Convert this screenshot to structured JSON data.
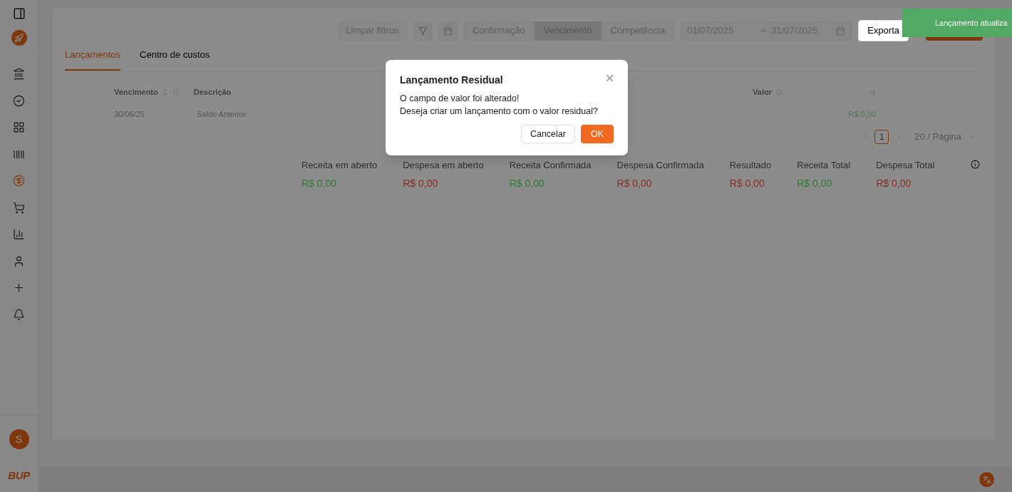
{
  "sidebar": {
    "nav_items": [
      {
        "kind": "bank",
        "selected": false
      },
      {
        "kind": "check",
        "selected": false
      },
      {
        "kind": "grid",
        "selected": false
      },
      {
        "kind": "barcode",
        "selected": false
      },
      {
        "kind": "dollar",
        "selected": true
      },
      {
        "kind": "cart",
        "selected": false
      },
      {
        "kind": "chart",
        "selected": false
      },
      {
        "kind": "user",
        "selected": false
      },
      {
        "kind": "plus",
        "selected": false
      },
      {
        "kind": "bell",
        "selected": false
      }
    ],
    "avatar": "S",
    "brand": "BUP"
  },
  "toolbar": {
    "clear_button": "Limpar filtros",
    "date_modes": [
      {
        "label": "Confirmação",
        "selected": false
      },
      {
        "label": "Vencimento",
        "selected": true
      },
      {
        "label": "Competência",
        "selected": false
      }
    ],
    "date_start": "01/07/2025",
    "date_end": "31/07/2025",
    "export_button": "Exporta"
  },
  "tabs": [
    {
      "label": "Lançamentos",
      "selected": true
    },
    {
      "label": "Centro de custos",
      "selected": false
    }
  ],
  "table": {
    "columns": [
      "Vencimento",
      "Descrição",
      "Valor"
    ],
    "rows": [
      {
        "date": "30/06/25",
        "description": "Saldo Anterior",
        "value": "R$ 0,00"
      }
    ]
  },
  "pagination": {
    "page": "1",
    "page_size": "20 / Página"
  },
  "summary": [
    {
      "label": "Receita em aberto",
      "value": "R$ 0,00",
      "color": "#2f7a34"
    },
    {
      "label": "Despesa em aberto",
      "value": "R$ 0,00",
      "color": "#8c2b22"
    },
    {
      "label": "Receita Confirmada",
      "value": "R$ 0,00",
      "color": "#2f7a34"
    },
    {
      "label": "Despesa Confirmada",
      "value": "R$ 0,00",
      "color": "#8c2b22"
    },
    {
      "label": "Resultado",
      "value": "R$ 0,00",
      "color": "#8c2b22"
    },
    {
      "label": "Receita Total",
      "value": "R$ 0,00",
      "color": "#2f7a34"
    },
    {
      "label": "Despesa Total",
      "value": "R$ 0,00",
      "color": "#8c2b22"
    }
  ],
  "dialog": {
    "title": "Lançamento Residual",
    "lines": [
      "O campo de valor foi alterado!",
      "Deseja criar um lançamento com o valor residual?"
    ],
    "cancel": "Cancelar",
    "ok": "OK"
  },
  "toast": {
    "message": "Lançamento atualiza"
  }
}
